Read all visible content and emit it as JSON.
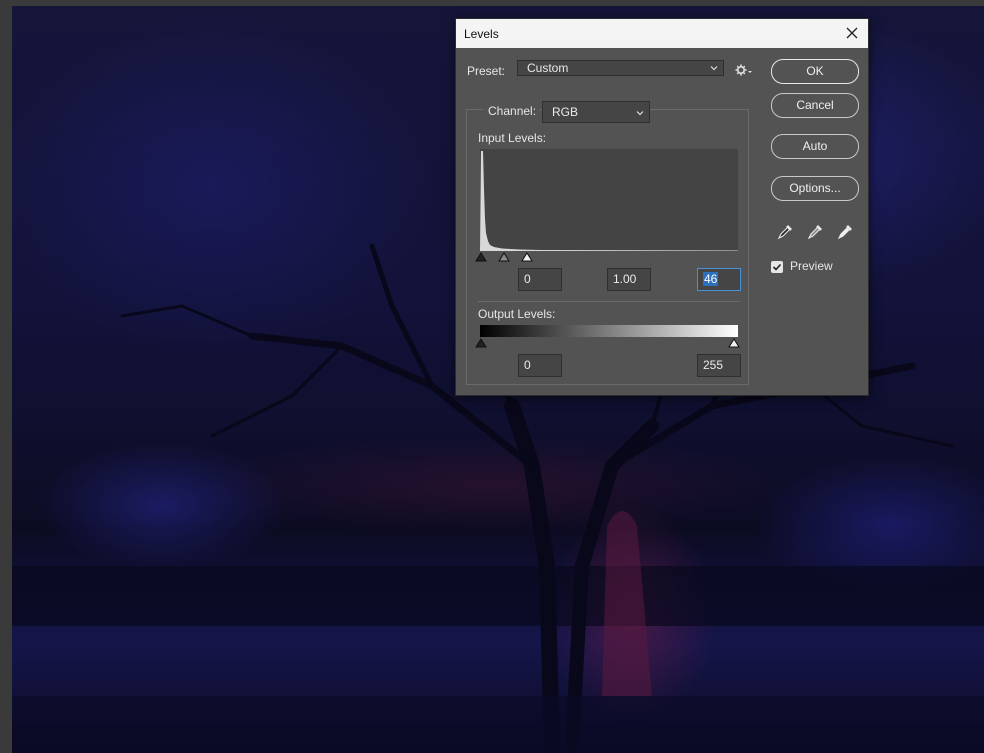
{
  "dialog": {
    "title": "Levels",
    "preset": {
      "label": "Preset:",
      "value": "Custom"
    },
    "channel": {
      "label": "Channel:",
      "value": "RGB"
    },
    "input_levels": {
      "label": "Input Levels:",
      "black": "0",
      "gamma": "1.00",
      "white": "46"
    },
    "output_levels": {
      "label": "Output Levels:",
      "black": "0",
      "white": "255"
    },
    "buttons": {
      "ok": "OK",
      "cancel": "Cancel",
      "auto": "Auto",
      "options": "Options..."
    },
    "preview": {
      "label": "Preview",
      "checked": true
    }
  },
  "icons": {
    "close": "close-icon",
    "gear": "gear-icon",
    "chevron": "chevron-down-icon",
    "black_eyedropper": "eyedropper-black-icon",
    "gray_eyedropper": "eyedropper-gray-icon",
    "white_eyedropper": "eyedropper-white-icon"
  },
  "colors": {
    "dialog_bg": "#535353",
    "field_bg": "#454545",
    "histogram_bg": "#444444",
    "selection": "#2c6fbf"
  }
}
